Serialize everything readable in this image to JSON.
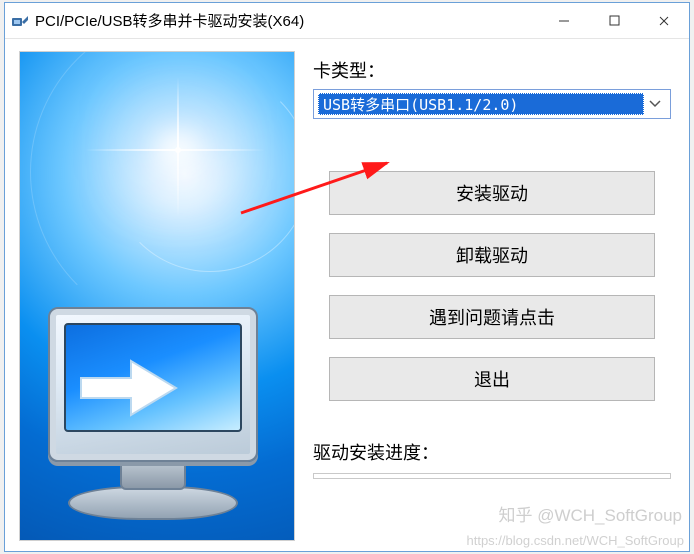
{
  "window": {
    "title": "PCI/PCIe/USB转多串并卡驱动安装(X64)"
  },
  "card_type": {
    "label": "卡类型：",
    "selected": "USB转多串口(USB1.1/2.0)"
  },
  "buttons": {
    "install": "安装驱动",
    "uninstall": "卸载驱动",
    "help": "遇到问题请点击",
    "exit": "退出"
  },
  "progress": {
    "label": "驱动安装进度："
  },
  "watermarks": {
    "zhihu": "知乎 @WCH_SoftGroup",
    "csdn": "https://blog.csdn.net/WCH_SoftGroup"
  }
}
